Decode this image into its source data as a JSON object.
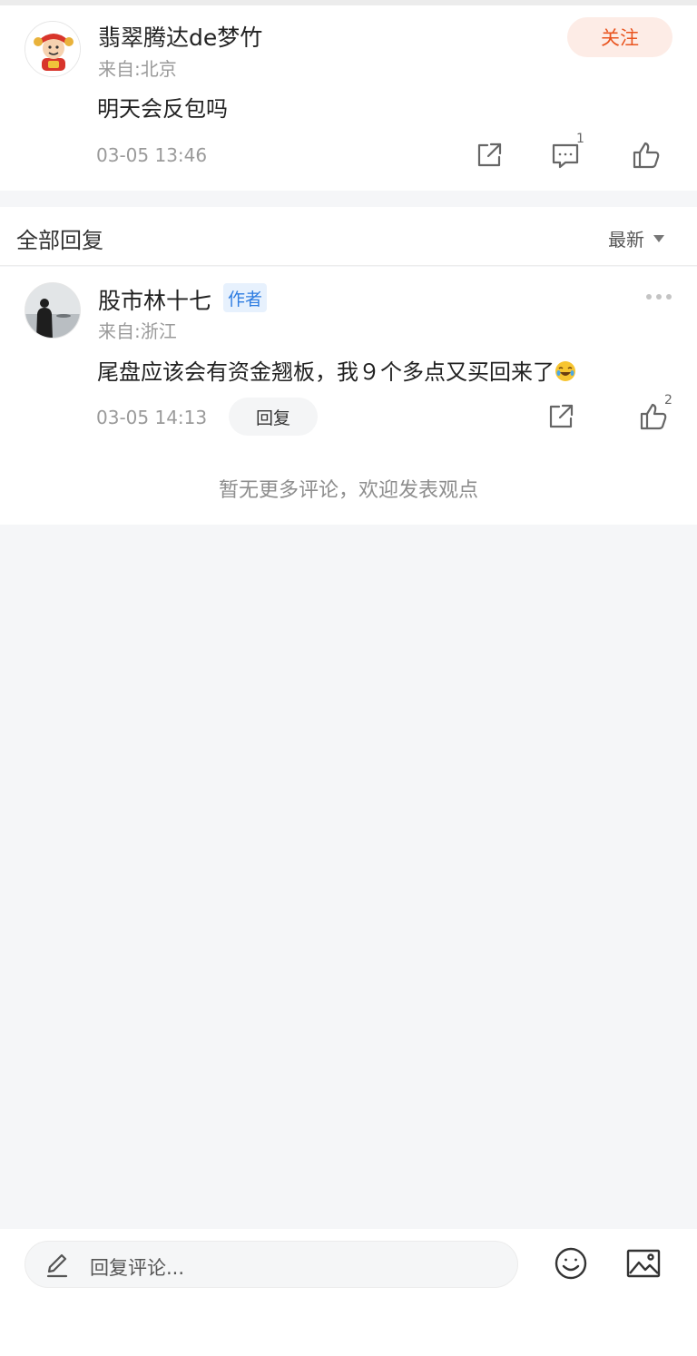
{
  "post": {
    "username": "翡翠腾达de梦竹",
    "location": "来自:北京",
    "follow_label": "关注",
    "content": "明天会反包吗",
    "timestamp": "03-05 13:46",
    "comment_count": "1"
  },
  "replies_header": {
    "title": "全部回复",
    "sort_label": "最新"
  },
  "reply": {
    "username": "股市林十七",
    "badge": "作者",
    "location": "来自:浙江",
    "content": "尾盘应该会有资金翘板，我９个多点又买回来了",
    "timestamp": "03-05 14:13",
    "reply_label": "回复",
    "like_count": "2"
  },
  "no_more_text": "暂无更多评论，欢迎发表观点",
  "bottom_bar": {
    "placeholder": "回复评论..."
  },
  "colors": {
    "accent": "#e9541f",
    "follow_bg": "#fdece6",
    "badge_text": "#2f7de1",
    "badge_bg": "#e7f1fd",
    "page_bg": "#f5f6f8"
  },
  "icons": [
    "share-icon",
    "comment-icon",
    "like-icon",
    "more-icon",
    "sort-caret-icon",
    "edit-pen-icon",
    "emoji-icon",
    "image-icon",
    "laughing-emoji"
  ]
}
